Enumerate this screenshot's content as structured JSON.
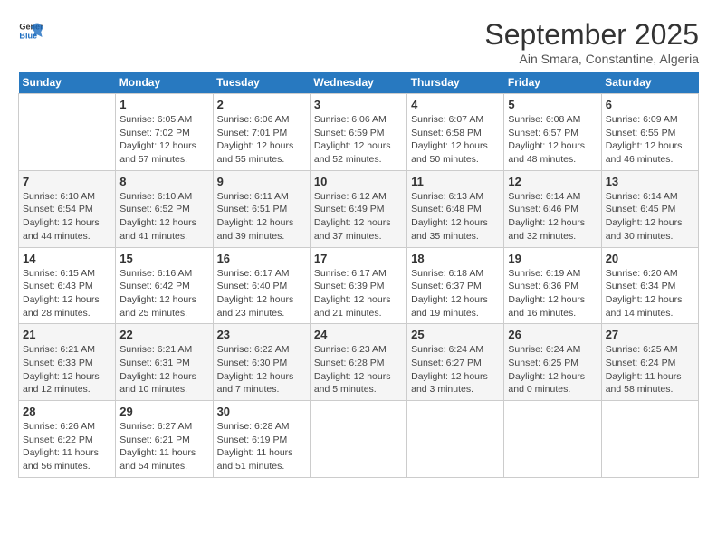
{
  "logo": {
    "text_general": "General",
    "text_blue": "Blue"
  },
  "title": "September 2025",
  "subtitle": "Ain Smara, Constantine, Algeria",
  "days_of_week": [
    "Sunday",
    "Monday",
    "Tuesday",
    "Wednesday",
    "Thursday",
    "Friday",
    "Saturday"
  ],
  "weeks": [
    [
      {
        "num": "",
        "info": ""
      },
      {
        "num": "1",
        "info": "Sunrise: 6:05 AM\nSunset: 7:02 PM\nDaylight: 12 hours\nand 57 minutes."
      },
      {
        "num": "2",
        "info": "Sunrise: 6:06 AM\nSunset: 7:01 PM\nDaylight: 12 hours\nand 55 minutes."
      },
      {
        "num": "3",
        "info": "Sunrise: 6:06 AM\nSunset: 6:59 PM\nDaylight: 12 hours\nand 52 minutes."
      },
      {
        "num": "4",
        "info": "Sunrise: 6:07 AM\nSunset: 6:58 PM\nDaylight: 12 hours\nand 50 minutes."
      },
      {
        "num": "5",
        "info": "Sunrise: 6:08 AM\nSunset: 6:57 PM\nDaylight: 12 hours\nand 48 minutes."
      },
      {
        "num": "6",
        "info": "Sunrise: 6:09 AM\nSunset: 6:55 PM\nDaylight: 12 hours\nand 46 minutes."
      }
    ],
    [
      {
        "num": "7",
        "info": "Sunrise: 6:10 AM\nSunset: 6:54 PM\nDaylight: 12 hours\nand 44 minutes."
      },
      {
        "num": "8",
        "info": "Sunrise: 6:10 AM\nSunset: 6:52 PM\nDaylight: 12 hours\nand 41 minutes."
      },
      {
        "num": "9",
        "info": "Sunrise: 6:11 AM\nSunset: 6:51 PM\nDaylight: 12 hours\nand 39 minutes."
      },
      {
        "num": "10",
        "info": "Sunrise: 6:12 AM\nSunset: 6:49 PM\nDaylight: 12 hours\nand 37 minutes."
      },
      {
        "num": "11",
        "info": "Sunrise: 6:13 AM\nSunset: 6:48 PM\nDaylight: 12 hours\nand 35 minutes."
      },
      {
        "num": "12",
        "info": "Sunrise: 6:14 AM\nSunset: 6:46 PM\nDaylight: 12 hours\nand 32 minutes."
      },
      {
        "num": "13",
        "info": "Sunrise: 6:14 AM\nSunset: 6:45 PM\nDaylight: 12 hours\nand 30 minutes."
      }
    ],
    [
      {
        "num": "14",
        "info": "Sunrise: 6:15 AM\nSunset: 6:43 PM\nDaylight: 12 hours\nand 28 minutes."
      },
      {
        "num": "15",
        "info": "Sunrise: 6:16 AM\nSunset: 6:42 PM\nDaylight: 12 hours\nand 25 minutes."
      },
      {
        "num": "16",
        "info": "Sunrise: 6:17 AM\nSunset: 6:40 PM\nDaylight: 12 hours\nand 23 minutes."
      },
      {
        "num": "17",
        "info": "Sunrise: 6:17 AM\nSunset: 6:39 PM\nDaylight: 12 hours\nand 21 minutes."
      },
      {
        "num": "18",
        "info": "Sunrise: 6:18 AM\nSunset: 6:37 PM\nDaylight: 12 hours\nand 19 minutes."
      },
      {
        "num": "19",
        "info": "Sunrise: 6:19 AM\nSunset: 6:36 PM\nDaylight: 12 hours\nand 16 minutes."
      },
      {
        "num": "20",
        "info": "Sunrise: 6:20 AM\nSunset: 6:34 PM\nDaylight: 12 hours\nand 14 minutes."
      }
    ],
    [
      {
        "num": "21",
        "info": "Sunrise: 6:21 AM\nSunset: 6:33 PM\nDaylight: 12 hours\nand 12 minutes."
      },
      {
        "num": "22",
        "info": "Sunrise: 6:21 AM\nSunset: 6:31 PM\nDaylight: 12 hours\nand 10 minutes."
      },
      {
        "num": "23",
        "info": "Sunrise: 6:22 AM\nSunset: 6:30 PM\nDaylight: 12 hours\nand 7 minutes."
      },
      {
        "num": "24",
        "info": "Sunrise: 6:23 AM\nSunset: 6:28 PM\nDaylight: 12 hours\nand 5 minutes."
      },
      {
        "num": "25",
        "info": "Sunrise: 6:24 AM\nSunset: 6:27 PM\nDaylight: 12 hours\nand 3 minutes."
      },
      {
        "num": "26",
        "info": "Sunrise: 6:24 AM\nSunset: 6:25 PM\nDaylight: 12 hours\nand 0 minutes."
      },
      {
        "num": "27",
        "info": "Sunrise: 6:25 AM\nSunset: 6:24 PM\nDaylight: 11 hours\nand 58 minutes."
      }
    ],
    [
      {
        "num": "28",
        "info": "Sunrise: 6:26 AM\nSunset: 6:22 PM\nDaylight: 11 hours\nand 56 minutes."
      },
      {
        "num": "29",
        "info": "Sunrise: 6:27 AM\nSunset: 6:21 PM\nDaylight: 11 hours\nand 54 minutes."
      },
      {
        "num": "30",
        "info": "Sunrise: 6:28 AM\nSunset: 6:19 PM\nDaylight: 11 hours\nand 51 minutes."
      },
      {
        "num": "",
        "info": ""
      },
      {
        "num": "",
        "info": ""
      },
      {
        "num": "",
        "info": ""
      },
      {
        "num": "",
        "info": ""
      }
    ]
  ]
}
